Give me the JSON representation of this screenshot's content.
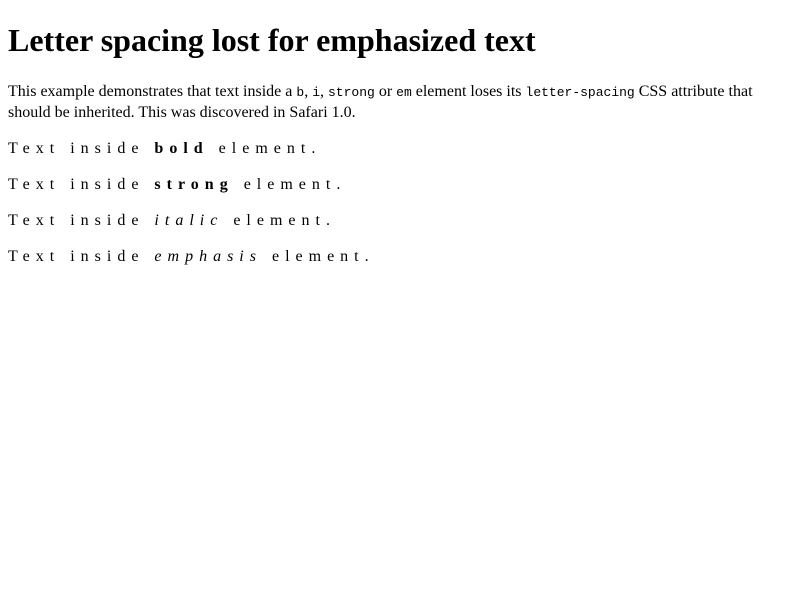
{
  "title": "Letter spacing lost for emphasized text",
  "intro": {
    "prefix": "This example demonstrates that text inside a ",
    "code_b": "b",
    "sep1": ", ",
    "code_i": "i",
    "sep2": ", ",
    "code_strong": "strong",
    "sep3": " or ",
    "code_em": "em",
    "middle": " element loses its ",
    "code_letter_spacing": "letter-spacing",
    "suffix": " CSS attribute that should be inherited. This was discovered in Safari 1.0."
  },
  "examples": [
    {
      "before": "Text inside ",
      "emphasized": "bold",
      "after": " element."
    },
    {
      "before": "Text inside ",
      "emphasized": "strong",
      "after": " element."
    },
    {
      "before": "Text inside ",
      "emphasized": "italic",
      "after": " element."
    },
    {
      "before": "Text inside ",
      "emphasized": "emphasis",
      "after": " element."
    }
  ]
}
